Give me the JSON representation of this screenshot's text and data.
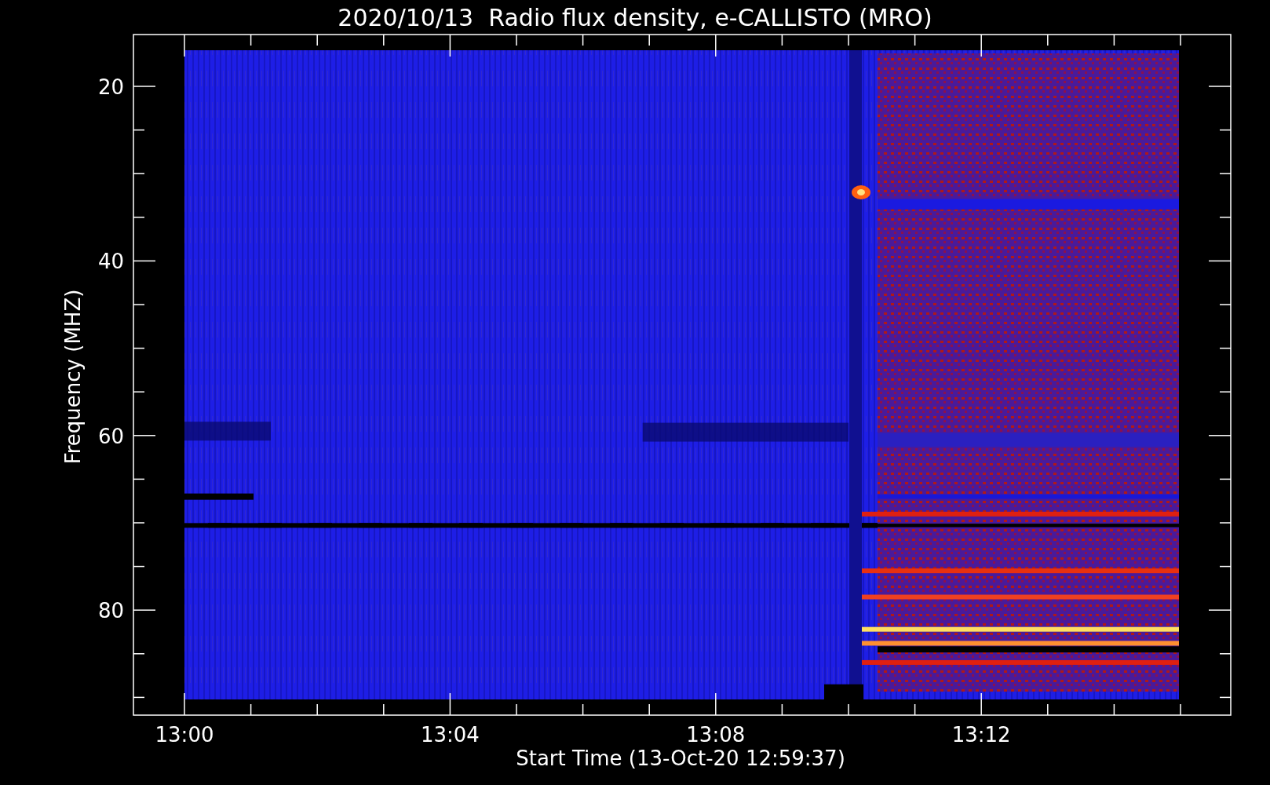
{
  "title": "2020/10/13  Radio flux density, e-CALLISTO (MRO)",
  "y_axis": {
    "label": "Frequency (MHZ)",
    "tick_labels": [
      "20",
      "40",
      "60",
      "80"
    ]
  },
  "x_axis": {
    "label": "Start Time (13-Oct-20 12:59:37)",
    "tick_labels": [
      "13:00",
      "13:04",
      "13:08",
      "13:12"
    ]
  }
}
